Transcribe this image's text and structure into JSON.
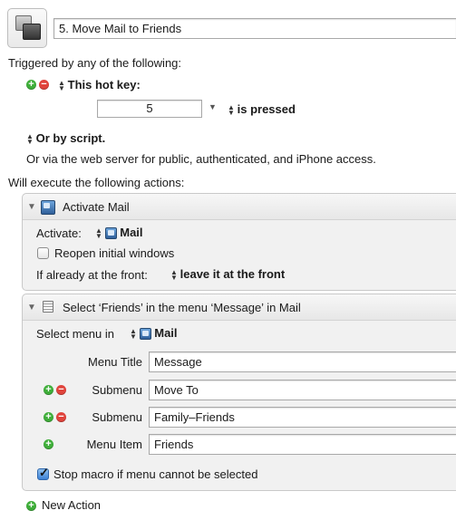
{
  "macro": {
    "name": "5. Move Mail to Friends"
  },
  "trigger": {
    "heading": "Triggered by any of the following:",
    "hotkey_label": "This hot key:",
    "hotkey_value": "5",
    "hotkey_state": "is pressed",
    "script_label": "Or by script.",
    "web_text": "Or via the web server for public, authenticated, and iPhone access."
  },
  "actions": {
    "heading": "Will execute the following actions:",
    "activate": {
      "title": "Activate Mail",
      "activate_label": "Activate:",
      "app": "Mail",
      "reopen_label": "Reopen initial windows",
      "reopen_checked": false,
      "front_label": "If already at the front:",
      "front_value": "leave it at the front"
    },
    "select_menu": {
      "title": "Select ‘Friends’ in the menu ‘Message’ in Mail",
      "select_in_label": "Select menu in",
      "app": "Mail",
      "rows": [
        {
          "label": "Menu Title",
          "value": "Message"
        },
        {
          "label": "Submenu",
          "value": "Move To"
        },
        {
          "label": "Submenu",
          "value": "Family–Friends"
        },
        {
          "label": "Menu Item",
          "value": "Friends"
        }
      ],
      "stop_label": "Stop macro if menu cannot be selected",
      "stop_checked": true
    },
    "new_action_label": "New Action"
  }
}
